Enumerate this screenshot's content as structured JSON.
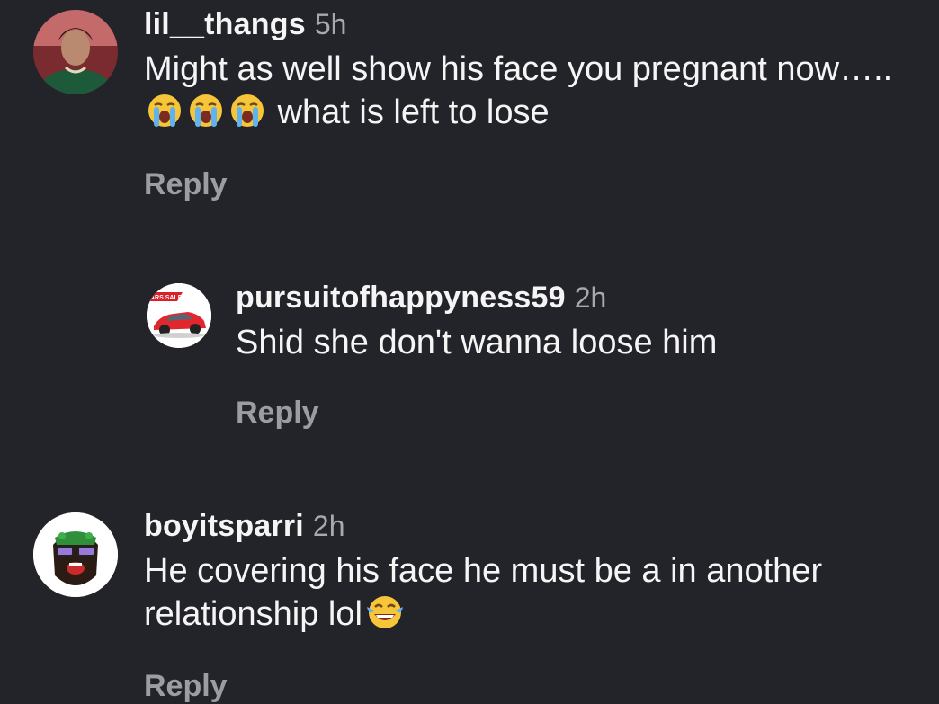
{
  "comments": [
    {
      "username": "lil__thangs",
      "time": "5h",
      "text_before_emoji": "Might as well show his face you pregnant now…..",
      "emoji": [
        "loudly-crying-face",
        "loudly-crying-face",
        "loudly-crying-face"
      ],
      "text_after_emoji": " what is left to lose",
      "reply_label": "Reply",
      "avatar": "profile-photo-woman"
    },
    {
      "username": "pursuitofhappyness59",
      "time": "2h",
      "text": "Shid she don't wanna loose him",
      "reply_label": "Reply",
      "avatar": "red-car-logo",
      "avatar_banner_text": "ARS SALES"
    },
    {
      "username": "boyitsparri",
      "time": "2h",
      "text_before_emoji": "He covering his face he must be a in another relationship lol",
      "emoji": [
        "face-with-tears-of-joy"
      ],
      "reply_label": "Reply",
      "avatar": "cartoon-bearded-man"
    }
  ],
  "colors": {
    "background": "#232429",
    "primary_text": "#f5f5f5",
    "secondary_text": "#a8a9ae",
    "reply_text": "#9c9da3"
  }
}
